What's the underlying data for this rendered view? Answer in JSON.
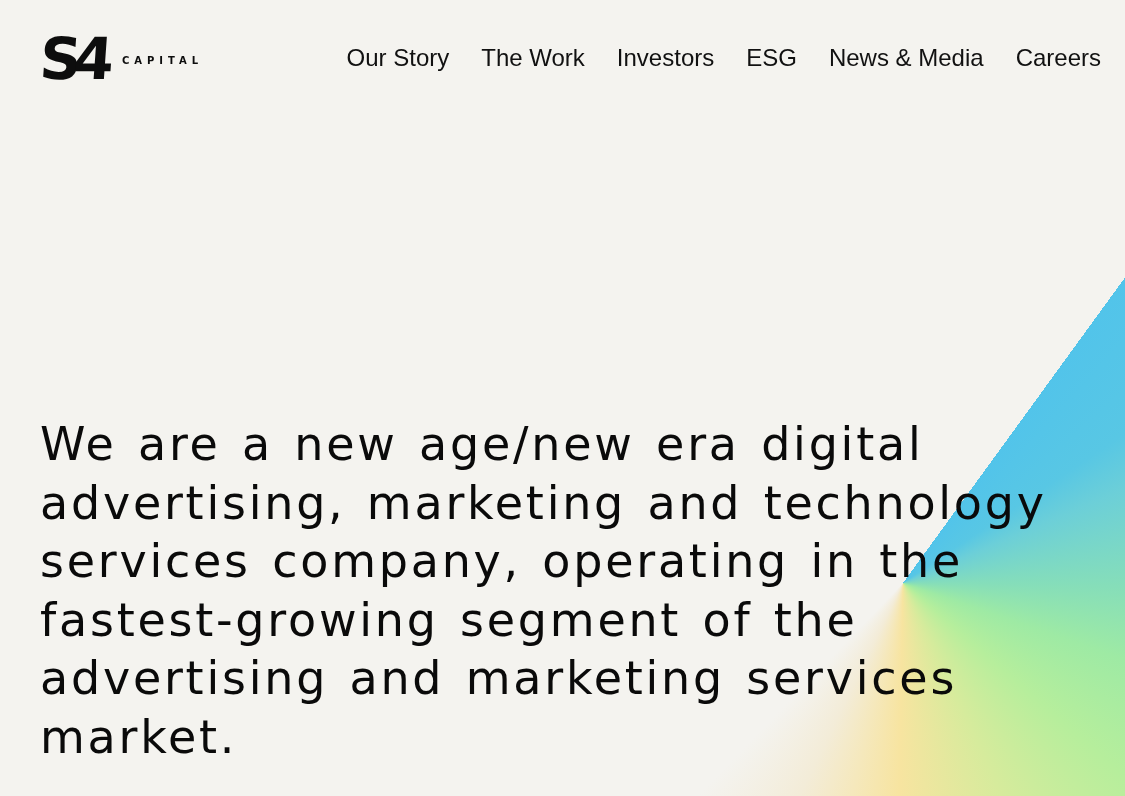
{
  "logo": {
    "mark": "S4",
    "wordmark": "CAPITAL"
  },
  "nav": [
    "Our Story",
    "The Work",
    "Investors",
    "ESG",
    "News & Media",
    "Careers"
  ],
  "hero": {
    "statement": "We are a new age/new era digital advertising, marketing and technology services company, operating in the fastest-growing segment of the advertising and marketing services market."
  }
}
